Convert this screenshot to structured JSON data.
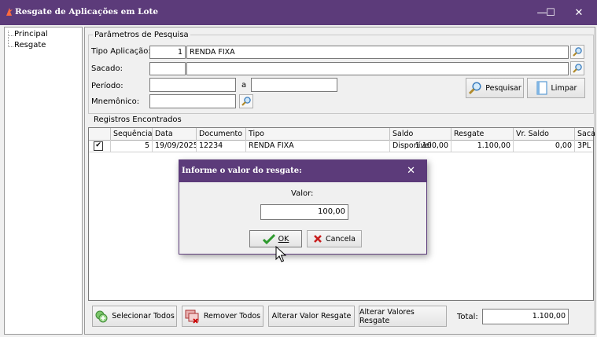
{
  "window": {
    "title": "Resgate de Aplicações em Lote",
    "minimize": "—",
    "maximize": "☐",
    "close": "✕"
  },
  "tree": {
    "items": [
      {
        "label": "Principal"
      },
      {
        "label": "Resgate"
      }
    ]
  },
  "search": {
    "legend": "Parâmetros de Pesquisa",
    "tipo_label": "Tipo Aplicação:",
    "tipo_code": "1",
    "tipo_desc": "RENDA FIXA",
    "sacado_label": "Sacado:",
    "sacado_code": "",
    "sacado_desc": "",
    "periodo_label": "Período:",
    "periodo_from": "",
    "periodo_sep": "a",
    "periodo_to": "",
    "mnemonico_label": "Mnemônico:",
    "mnemonico_value": "",
    "pesquisar_label": "Pesquisar",
    "limpar_label": "Limpar"
  },
  "results": {
    "legend": "Registros Encontrados",
    "columns": [
      "Sequência",
      "Data",
      "Documento",
      "Tipo",
      "Saldo Disponível",
      "Resgate",
      "Vr. Saldo",
      "Saca"
    ],
    "rows": [
      {
        "checked": "✔",
        "sequencia": "5",
        "data": "19/09/2025",
        "documento": "12234",
        "tipo": "RENDA FIXA",
        "saldo": "1.100,00",
        "resgate": "1.100,00",
        "vr_saldo": "0,00",
        "sacado": "3PL"
      }
    ]
  },
  "footer": {
    "selecionar_todos": "Selecionar Todos",
    "remover_todos": "Remover Todos",
    "alterar_valor": "Alterar Valor Resgate",
    "alterar_valores": "Alterar Valores Resgate",
    "total_label": "Total:",
    "total_value": "1.100,00"
  },
  "dialog": {
    "title": "Informe o valor do resgate:",
    "close": "✕",
    "valor_label": "Valor:",
    "valor_value": "100,00",
    "ok_label": "OK",
    "cancela_label": "Cancela"
  },
  "colors": {
    "titlebar": "#5c3b7a",
    "ok_check": "#2e9a2e",
    "cancel_x": "#c81e1e"
  }
}
